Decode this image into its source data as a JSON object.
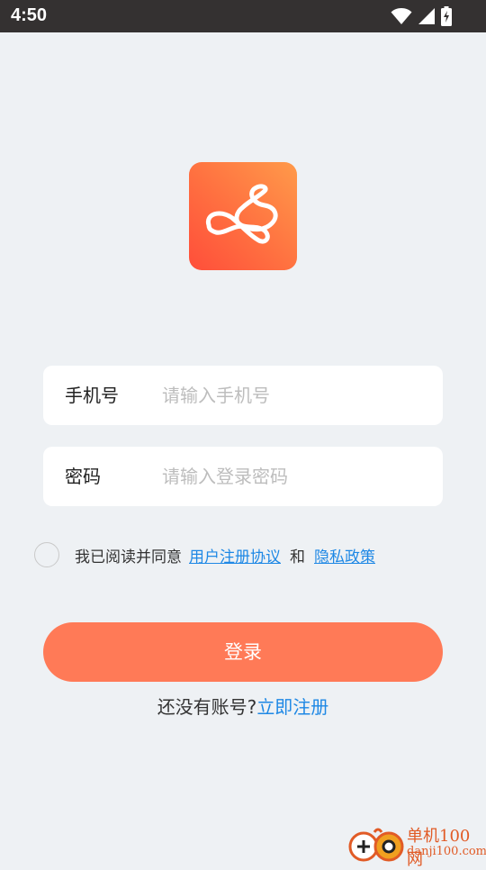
{
  "status_bar": {
    "time": "4:50",
    "icons": [
      "wifi-icon",
      "signal-icon",
      "battery-charging-icon"
    ]
  },
  "logo": {
    "icon": "rabbit-scribble-logo-icon",
    "colors": [
      "#ff4e3a",
      "#ff9a4a"
    ]
  },
  "form": {
    "phone": {
      "label": "手机号",
      "placeholder": "请输入手机号",
      "value": ""
    },
    "password": {
      "label": "密码",
      "placeholder": "请输入登录密码",
      "value": ""
    }
  },
  "agreement": {
    "checked": false,
    "prefix": "我已阅读并同意",
    "terms_link": "用户注册协议",
    "and_text": "和",
    "privacy_link": "隐私政策"
  },
  "login_button": {
    "label": "登录",
    "color": "#ff7a57"
  },
  "register": {
    "prompt": "还没有账号?",
    "link": "立即注册"
  },
  "watermark": {
    "title": "单机100网",
    "url": "danji100.com"
  },
  "colors": {
    "background": "#eef1f4",
    "link": "#1e88e5",
    "status_bar": "#343131"
  }
}
